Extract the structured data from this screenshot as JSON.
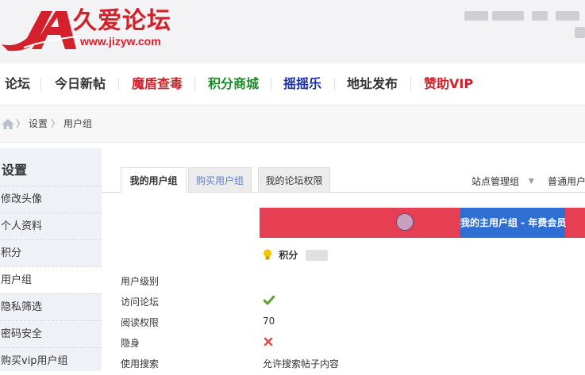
{
  "header": {
    "logo_cn": "久爱论坛",
    "logo_url": "www.jizyw.com"
  },
  "nav": {
    "items": [
      {
        "label": "论坛",
        "color": "#333333"
      },
      {
        "label": "今日新帖",
        "color": "#333333"
      },
      {
        "label": "魔盾查毒",
        "color": "#d0202a"
      },
      {
        "label": "积分商城",
        "color": "#1d8a2a"
      },
      {
        "label": "摇摇乐",
        "color": "#1a2fa0"
      },
      {
        "label": "地址发布",
        "color": "#333333"
      },
      {
        "label": "赞助VIP",
        "color": "#d0202a"
      }
    ]
  },
  "breadcrumb": {
    "home_icon": "home-icon",
    "sep": "〉",
    "items": [
      "设置",
      "用户组"
    ]
  },
  "sidebar": {
    "title": "设置",
    "items": [
      {
        "label": "修改头像",
        "active": false
      },
      {
        "label": "个人资料",
        "active": false
      },
      {
        "label": "积分",
        "active": false
      },
      {
        "label": "用户组",
        "active": true
      },
      {
        "label": "隐私筛选",
        "active": false
      },
      {
        "label": "密码安全",
        "active": false
      },
      {
        "label": "购买vip用户组",
        "active": false
      }
    ]
  },
  "tabs": [
    {
      "label": "我的用户组",
      "state": "active"
    },
    {
      "label": "购买用户组",
      "state": "link"
    },
    {
      "label": "我的论坛权限",
      "state": "normal"
    }
  ],
  "group_select": {
    "admin_label": "站点管理组",
    "normal_label": "普通用户"
  },
  "group_bar": {
    "main_group_label": "我的主用户组 - 年费会员",
    "bar_color": "#e63e52",
    "highlight_color": "#2f6fd4"
  },
  "points": {
    "icon": "lightbulb-icon",
    "label": "积分"
  },
  "permissions": {
    "rows": [
      {
        "label": "用户级别",
        "value": ""
      },
      {
        "label": "访问论坛",
        "value": "",
        "icon": "check-icon"
      },
      {
        "label": "阅读权限",
        "value": "70"
      },
      {
        "label": "隐身",
        "value": "",
        "icon": "cross-icon"
      },
      {
        "label": "使用搜索",
        "value": "允许搜索帖子内容"
      }
    ]
  }
}
